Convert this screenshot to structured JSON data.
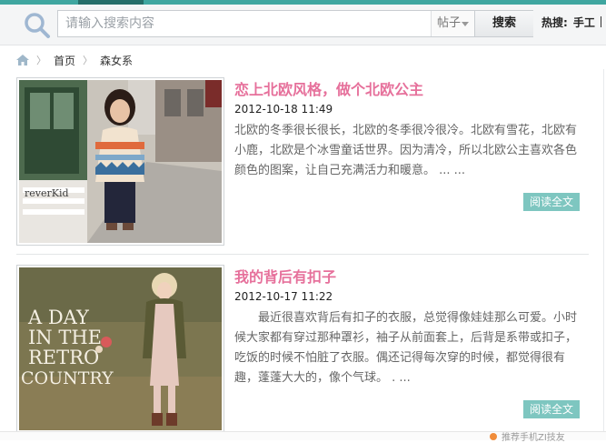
{
  "search": {
    "placeholder": "请输入搜索内容",
    "scope_label": "帖子",
    "button_label": "搜索",
    "hot_label": "热搜:",
    "hot_keyword": "手工"
  },
  "breadcrumb": {
    "home": "首页",
    "current": "森女系"
  },
  "posts": [
    {
      "title": "恋上北欧风格，做个北欧公主",
      "date": "2012-10-18 11:49",
      "excerpt": "北欧的冬季很长很长，北欧的冬季很冷很冷。北欧有雪花，北欧有小鹿，北欧是个冰雪童话世界。因为清冷，所以北欧公主喜欢各色颜色的图案，让自己充满活力和暖意。 ... ...",
      "read_more": "阅读全文",
      "image_sign_text": "reverKid"
    },
    {
      "title": "我的背后有扣子",
      "date": "2012-10-17 11:22",
      "excerpt": "最近很喜欢背后有扣子的衣服，总觉得像娃娃那么可爱。小时候大家都有穿过那种罩衫，袖子从前面套上，后背是系带或扣子，吃饭的时候不怕脏了衣服。偶还记得每次穿的时候，都觉得很有趣，蓬蓬大大的，像个气球。 . ...",
      "read_more": "阅读全文",
      "image_overlay_text": [
        "A DAY",
        "IN THE",
        "RETRO",
        "COUNTRY"
      ]
    }
  ],
  "footer": {
    "partial_text": "推荐手机ZI技友"
  }
}
